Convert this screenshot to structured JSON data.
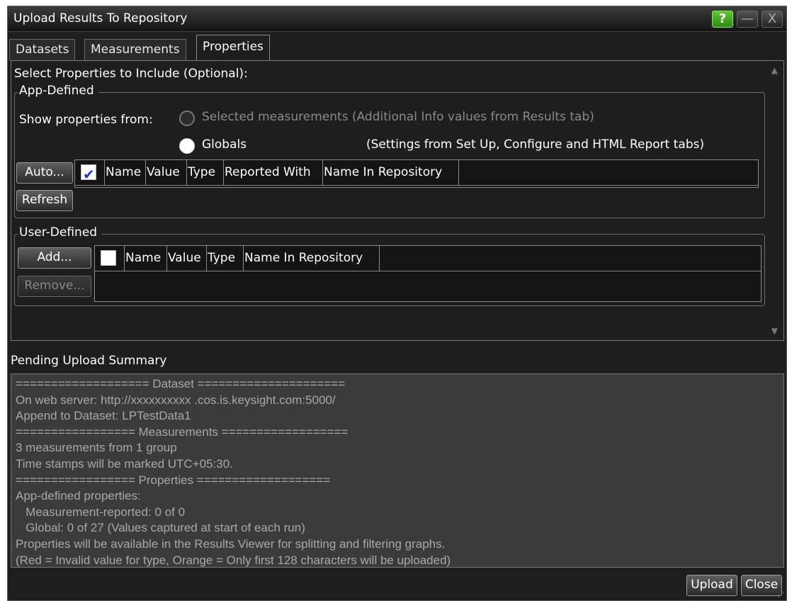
{
  "window": {
    "title": "Upload Results To Repository"
  },
  "titlebar": {
    "help": "?",
    "minimize": "—",
    "close": "X"
  },
  "tabs": [
    {
      "label": "Datasets",
      "active": false
    },
    {
      "label": "Measurements",
      "active": false
    },
    {
      "label": "Properties",
      "active": true
    }
  ],
  "properties": {
    "heading": "Select Properties to Include (Optional):",
    "app_defined": {
      "legend": "App-Defined",
      "show_from_label": "Show properties from:",
      "radio_selected_meas": "Selected measurements (Additional Info values from Results tab)",
      "radio_globals": "Globals",
      "globals_note": "(Settings from Set Up, Configure and HTML Report tabs)",
      "auto_button": "Auto...",
      "refresh_button": "Refresh",
      "columns": [
        "Name",
        "Value",
        "Type",
        "Reported With",
        "Name In Repository"
      ],
      "select_all_checked": true
    },
    "user_defined": {
      "legend": "User-Defined",
      "add_button": "Add...",
      "remove_button": "Remove...",
      "columns": [
        "Name",
        "Value",
        "Type",
        "Name In Repository"
      ],
      "select_all_checked": false
    }
  },
  "summary": {
    "label": "Pending Upload Summary",
    "lines": [
      "=================== Dataset =====================",
      "On web server: http://xxxxxxxxxx .cos.is.keysight.com:5000/",
      "Append to Dataset: LPTestData1",
      "================= Measurements ==================",
      "3 measurements from 1 group",
      "Time stamps will be marked UTC+05:30.",
      "================= Properties ===================",
      "App-defined properties:",
      "   Measurement-reported: 0 of 0",
      "   Global: 0 of 27 (Values captured at start of each run)",
      "Properties will be available in the Results Viewer for splitting and filtering graphs.",
      "(Red = Invalid value for type, Orange = Only first 128 characters will be uploaded)"
    ]
  },
  "footer": {
    "upload_button": "Upload",
    "close_button": "Close"
  },
  "colors": {
    "window_bg": "#1e1e1e",
    "summary_bg": "#3b3b3b",
    "help_green": "#4bb323",
    "check_blue": "#1a3bd6"
  }
}
